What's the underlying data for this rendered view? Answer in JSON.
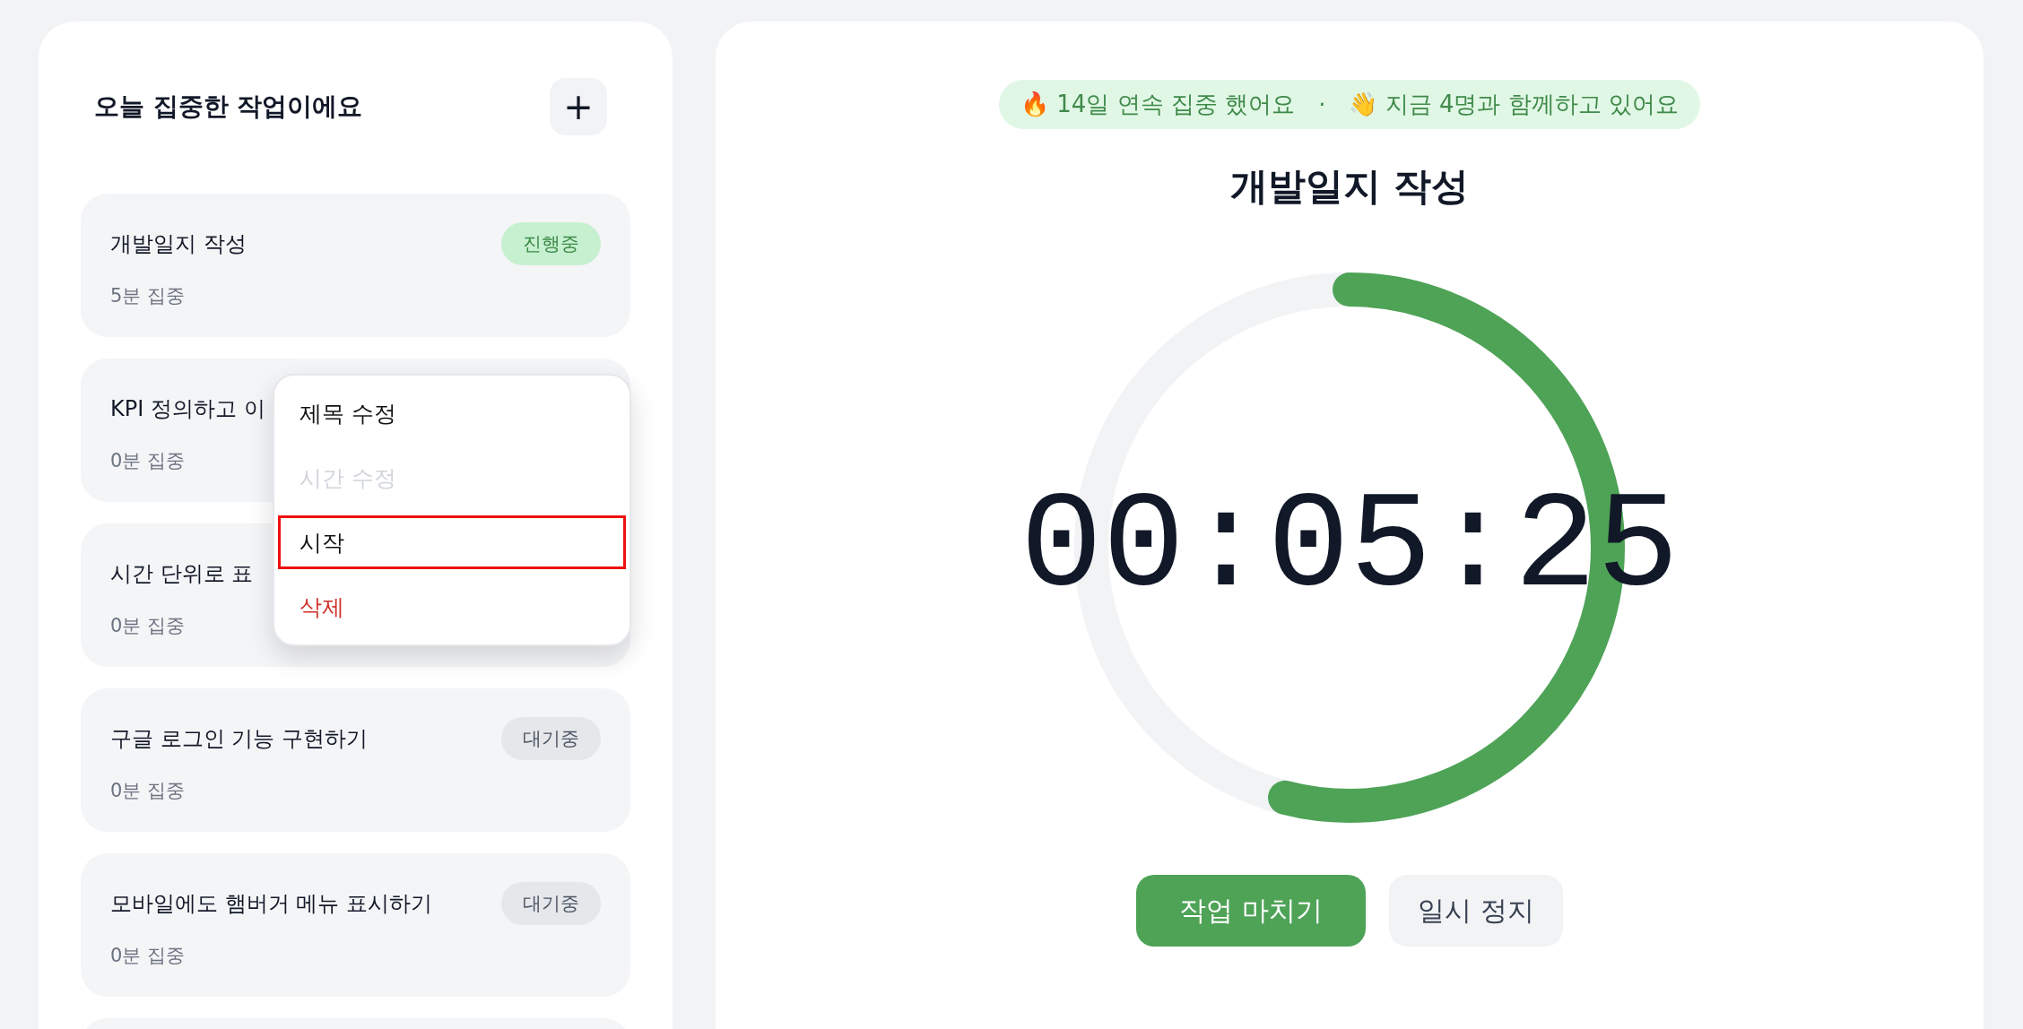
{
  "task_panel": {
    "title": "오늘 집중한 작업이에요",
    "add_button": "+",
    "tasks": [
      {
        "title": "개발일지 작성",
        "focus": "5분 집중",
        "status": {
          "label": "진행중",
          "kind": "active"
        }
      },
      {
        "title": "KPI 정의하고 이",
        "focus": "0분 집중"
      },
      {
        "title": "시간 단위로 표",
        "focus": "0분 집중"
      },
      {
        "title": "구글 로그인 기능 구현하기",
        "focus": "0분 집중",
        "status": {
          "label": "대기중",
          "kind": "waiting"
        }
      },
      {
        "title": "모바일에도 햄버거 메뉴 표시하기",
        "focus": "0분 집중",
        "status": {
          "label": "대기중",
          "kind": "waiting"
        }
      }
    ],
    "context_menu": [
      {
        "label": "제목 수정",
        "kind": "normal",
        "disabled": false,
        "selected": false
      },
      {
        "label": "시간 수정",
        "kind": "normal",
        "disabled": true,
        "selected": false
      },
      {
        "label": "시작",
        "kind": "normal",
        "disabled": false,
        "selected": true
      },
      {
        "label": "삭제",
        "kind": "danger",
        "disabled": false,
        "selected": false
      }
    ]
  },
  "timer_panel": {
    "banner": [
      "🔥 14일 연속 집중 했어요",
      "·",
      "👋 지금 4명과 함께하고 있어요"
    ],
    "task_title": "개발일지 작성",
    "time": "00:05:25",
    "progress": {
      "level": 0.54
    },
    "buttons": [
      {
        "label": "작업 마치기",
        "kind": "primary"
      },
      {
        "label": "일시 정지",
        "kind": "secondary"
      }
    ]
  }
}
